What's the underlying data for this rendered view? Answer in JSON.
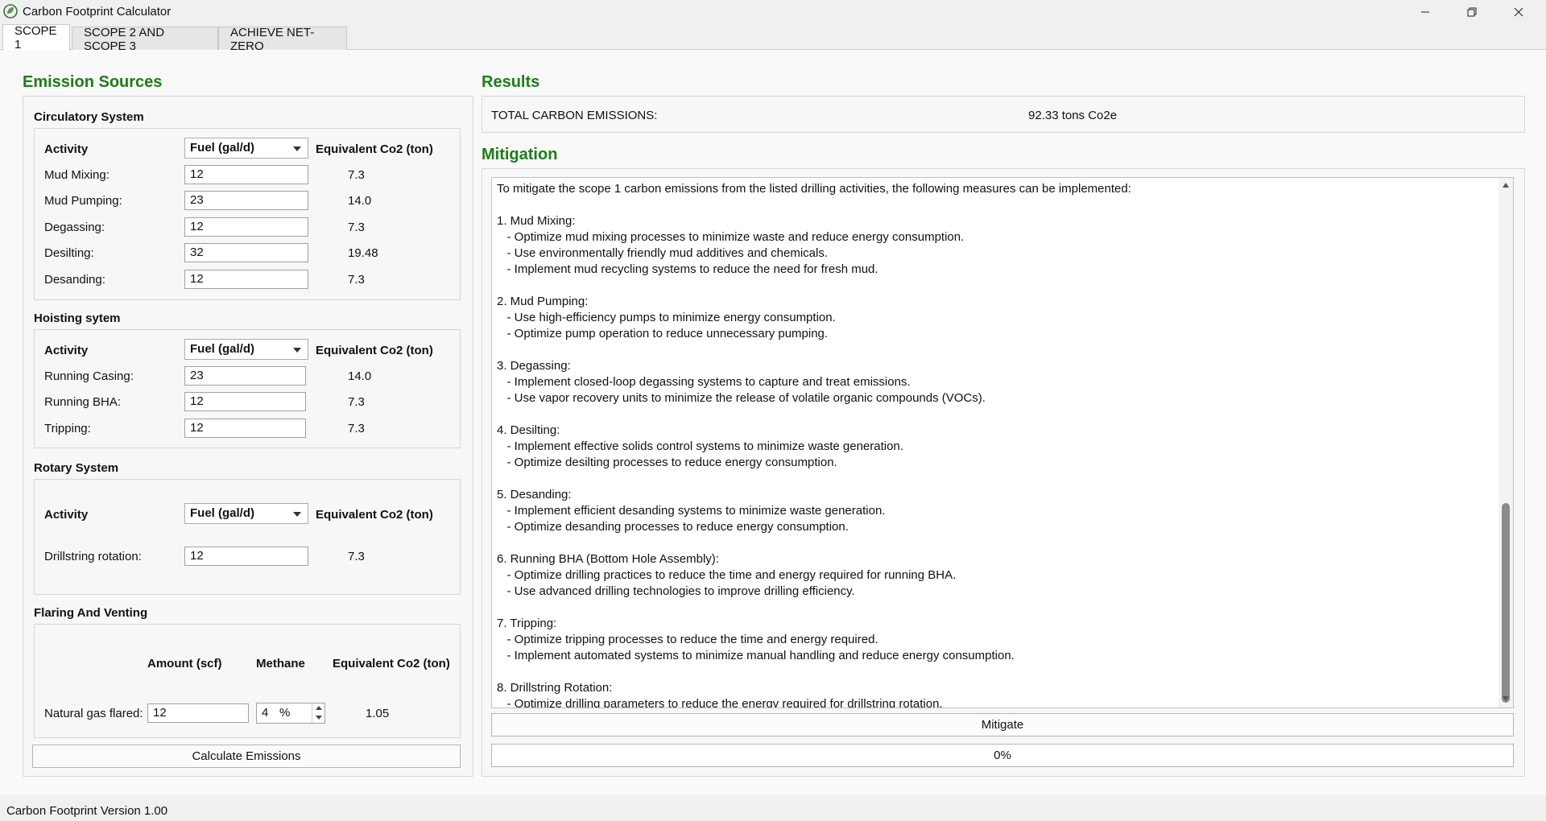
{
  "window": {
    "title": "Carbon Footprint Calculator",
    "icon": "leaf-globe-icon"
  },
  "tabs": [
    {
      "label": "SCOPE 1",
      "active": true
    },
    {
      "label": "SCOPE 2 AND SCOPE 3",
      "active": false
    },
    {
      "label": "ACHIEVE NET-ZERO",
      "active": false
    }
  ],
  "emission_sources": {
    "title": "Emission Sources",
    "circulatory": {
      "title": "Circulatory System",
      "activity_header": "Activity",
      "unit_select": "Fuel (gal/d)",
      "co2_header": "Equivalent Co2 (ton)",
      "rows": [
        {
          "label": "Mud Mixing:",
          "value": "12",
          "co2": "7.3"
        },
        {
          "label": "Mud Pumping:",
          "value": "23",
          "co2": "14.0"
        },
        {
          "label": "Degassing:",
          "value": "12",
          "co2": "7.3"
        },
        {
          "label": "Desilting:",
          "value": "32",
          "co2": "19.48"
        },
        {
          "label": "Desanding:",
          "value": "12",
          "co2": "7.3"
        }
      ]
    },
    "hoisting": {
      "title": "Hoisting sytem",
      "activity_header": "Activity",
      "unit_select": "Fuel (gal/d)",
      "co2_header": "Equivalent Co2 (ton)",
      "rows": [
        {
          "label": "Running Casing:",
          "value": "23",
          "co2": "14.0"
        },
        {
          "label": "Running BHA:",
          "value": "12",
          "co2": "7.3"
        },
        {
          "label": "Tripping:",
          "value": "12",
          "co2": "7.3"
        }
      ]
    },
    "rotary": {
      "title": "Rotary System",
      "activity_header": "Activity",
      "unit_select": "Fuel (gal/d)",
      "co2_header": "Equivalent Co2 (ton)",
      "rows": [
        {
          "label": "Drillstring rotation:",
          "value": "12",
          "co2": "7.3"
        }
      ]
    },
    "flaring": {
      "title": "Flaring And Venting",
      "amount_header": "Amount (scf)",
      "methane_header": "Methane",
      "co2_header": "Equivalent Co2 (ton)",
      "row": {
        "label": "Natural gas flared:",
        "amount": "12",
        "methane_value": "4",
        "methane_unit": "%",
        "co2": "1.05"
      }
    },
    "calculate_label": "Calculate Emissions"
  },
  "results": {
    "title": "Results",
    "total_label": "TOTAL CARBON EMISSIONS:",
    "total_value": "92.33 tons Co2e"
  },
  "mitigation": {
    "title": "Mitigation",
    "text": "To mitigate the scope 1 carbon emissions from the listed drilling activities, the following measures can be implemented:\n\n1. Mud Mixing:\n   - Optimize mud mixing processes to minimize waste and reduce energy consumption.\n   - Use environmentally friendly mud additives and chemicals.\n   - Implement mud recycling systems to reduce the need for fresh mud.\n\n2. Mud Pumping:\n   - Use high-efficiency pumps to minimize energy consumption.\n   - Optimize pump operation to reduce unnecessary pumping.\n\n3. Degassing:\n   - Implement closed-loop degassing systems to capture and treat emissions.\n   - Use vapor recovery units to minimize the release of volatile organic compounds (VOCs).\n\n4. Desilting:\n   - Implement effective solids control systems to minimize waste generation.\n   - Optimize desilting processes to reduce energy consumption.\n\n5. Desanding:\n   - Implement efficient desanding systems to minimize waste generation.\n   - Optimize desanding processes to reduce energy consumption.\n\n6. Running BHA (Bottom Hole Assembly):\n   - Optimize drilling practices to reduce the time and energy required for running BHA.\n   - Use advanced drilling technologies to improve drilling efficiency.\n\n7. Tripping:\n   - Optimize tripping processes to reduce the time and energy required.\n   - Implement automated systems to minimize manual handling and reduce energy consumption.\n\n8. Drillstring Rotation:\n   - Optimize drilling parameters to reduce the energy required for drillstring rotation.",
    "mitigate_label": "Mitigate",
    "progress_label": "0%",
    "progress": 0
  },
  "status": {
    "text": "Carbon Footprint Version 1.00"
  },
  "colors": {
    "section_title": "#1e7d17"
  }
}
